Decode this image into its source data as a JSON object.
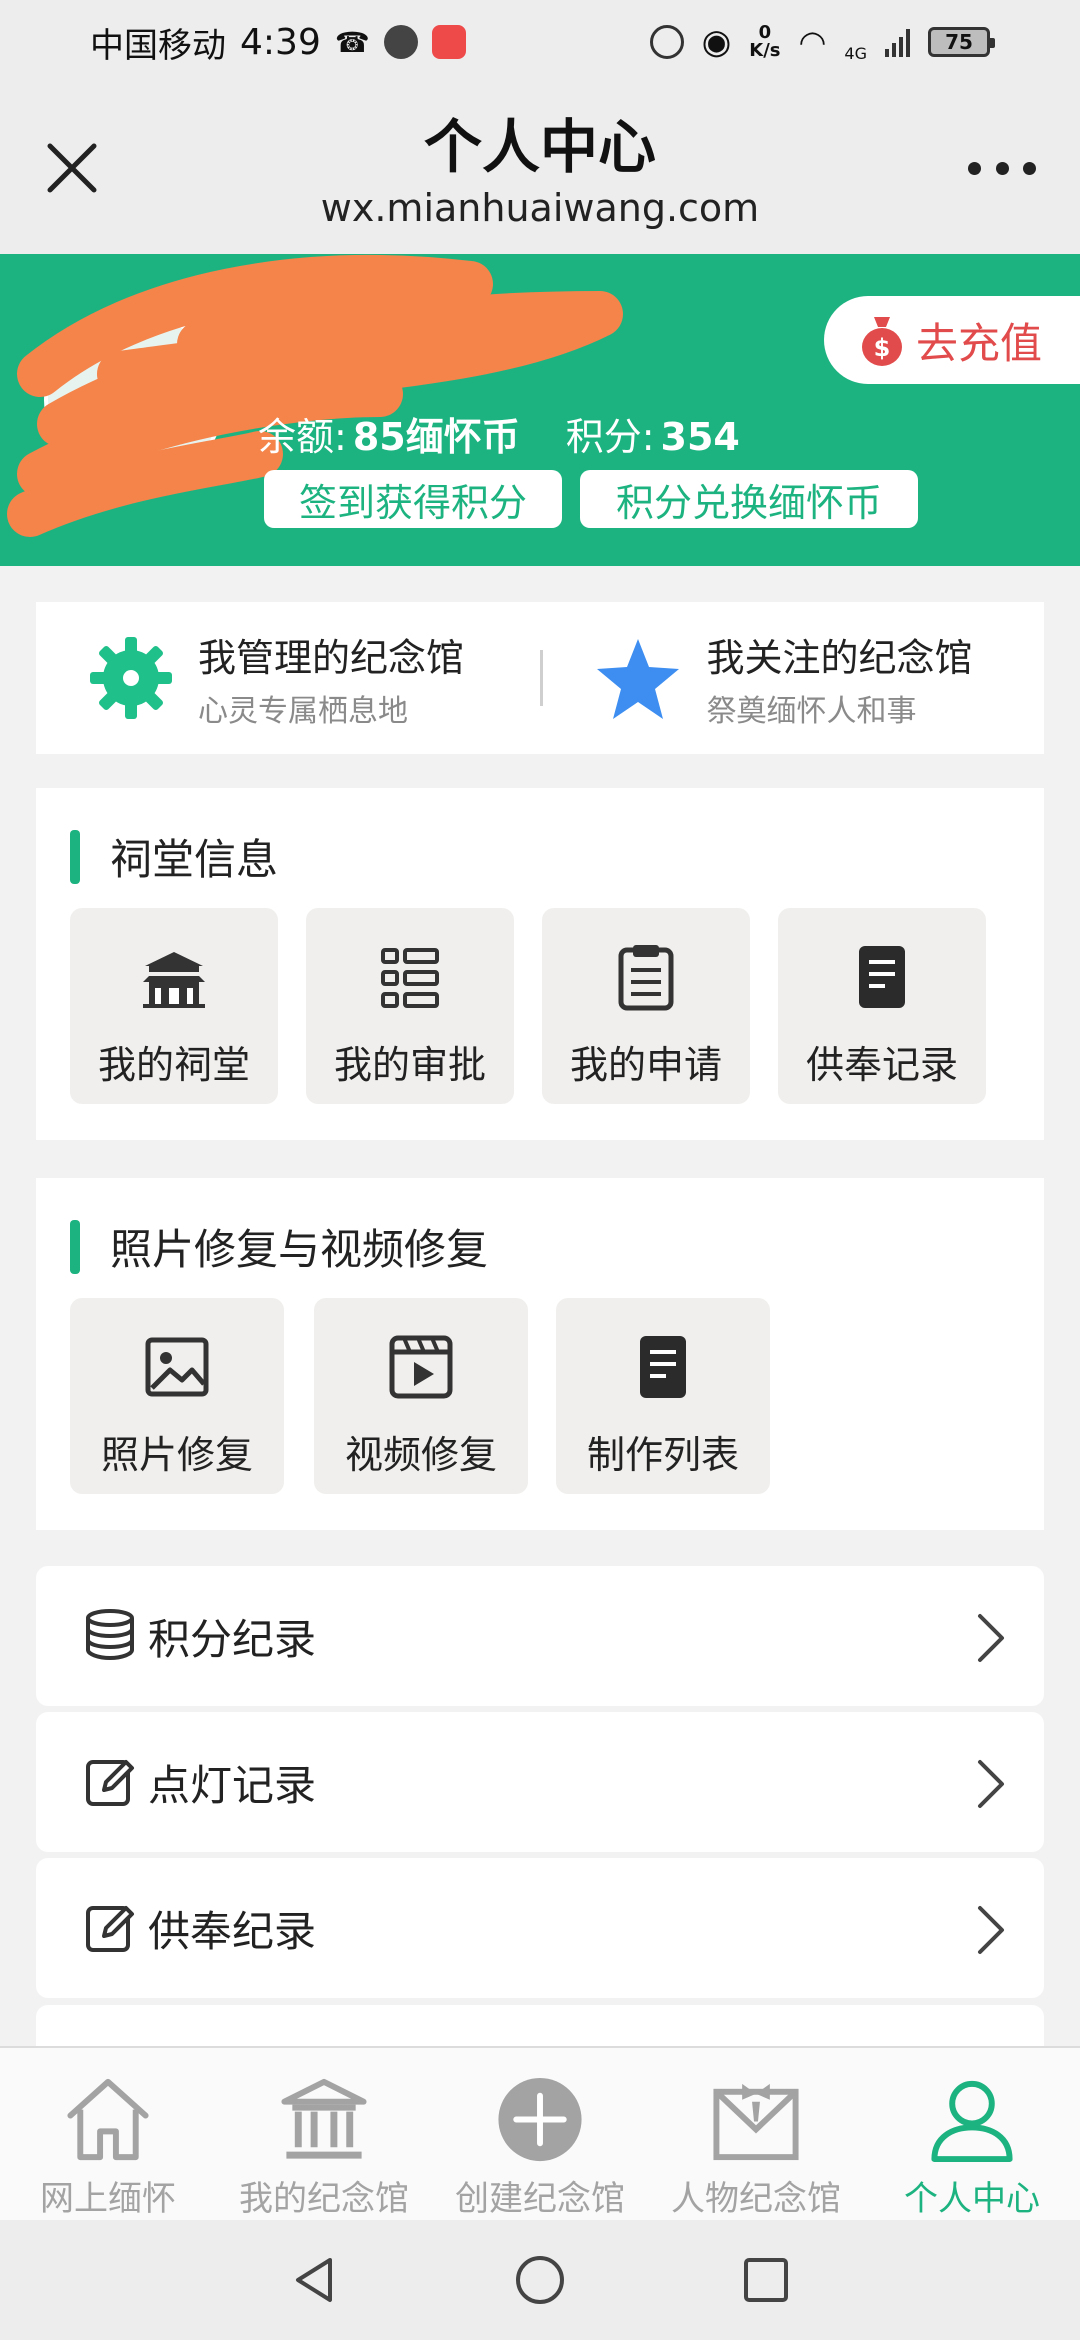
{
  "status_bar": {
    "carrier": "中国移动",
    "time": "4:39",
    "net_speed_value": "0",
    "net_speed_unit": "K/s",
    "network": "4G",
    "battery": "75"
  },
  "title_bar": {
    "title": "个人中心",
    "url": "wx.mianhuaiwang.com"
  },
  "profile": {
    "recharge_label": "去充值",
    "balance_label": "余额:",
    "balance_value": "85缅怀币",
    "points_label": "积分:",
    "points_value": "354",
    "checkin_label": "签到获得积分",
    "exchange_label": "积分兑换缅怀币"
  },
  "memorials": [
    {
      "title": "我管理的纪念馆",
      "subtitle": "心灵专属栖息地",
      "icon": "gear-icon"
    },
    {
      "title": "我关注的纪念馆",
      "subtitle": "祭奠缅怀人和事",
      "icon": "star-icon"
    }
  ],
  "ancestral": {
    "title": "祠堂信息",
    "tiles": [
      {
        "label": "我的祠堂",
        "icon": "temple-icon"
      },
      {
        "label": "我的审批",
        "icon": "list-grid-icon"
      },
      {
        "label": "我的申请",
        "icon": "clipboard-icon"
      },
      {
        "label": "供奉记录",
        "icon": "document-icon"
      }
    ]
  },
  "restore": {
    "title": "照片修复与视频修复",
    "tiles": [
      {
        "label": "照片修复",
        "icon": "image-icon"
      },
      {
        "label": "视频修复",
        "icon": "video-icon"
      },
      {
        "label": "制作列表",
        "icon": "document-icon"
      }
    ]
  },
  "list": [
    {
      "label": "积分纪录",
      "icon": "coins-icon"
    },
    {
      "label": "点灯记录",
      "icon": "edit-icon"
    },
    {
      "label": "供奉纪录",
      "icon": "edit-icon"
    }
  ],
  "bottom_nav": [
    {
      "label": "网上缅怀",
      "icon": "home-icon",
      "active": false
    },
    {
      "label": "我的纪念馆",
      "icon": "museum-icon",
      "active": false
    },
    {
      "label": "创建纪念馆",
      "icon": "plus-circle-icon",
      "active": false
    },
    {
      "label": "人物纪念馆",
      "icon": "person-memorial-icon",
      "active": false
    },
    {
      "label": "个人中心",
      "icon": "user-icon",
      "active": true
    }
  ],
  "colors": {
    "brand_green": "#1db381",
    "accent_red": "#e24b4b",
    "inactive_gray": "#a3a3a3"
  }
}
